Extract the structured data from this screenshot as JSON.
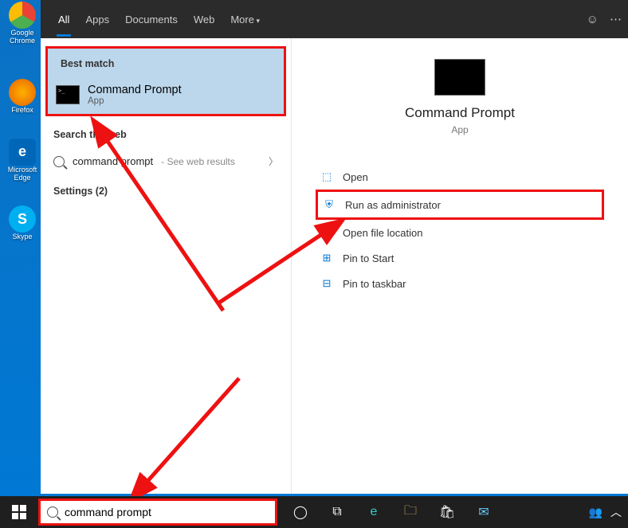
{
  "desktop": {
    "icons": [
      {
        "label": "Google Chrome",
        "color": "#fff"
      },
      {
        "label": "Firefox",
        "color": "#ff7139"
      },
      {
        "label": "Microsoft Edge",
        "color": "#0067b8"
      },
      {
        "label": "Skype",
        "color": "#00aff0"
      }
    ]
  },
  "tabs": {
    "items": [
      "All",
      "Apps",
      "Documents",
      "Web",
      "More"
    ],
    "active": 0
  },
  "left": {
    "best_match_label": "Best match",
    "best_match": {
      "title": "Command Prompt",
      "subtitle": "App"
    },
    "search_web_label": "Search the web",
    "web_query": "command prompt",
    "web_hint": " - See web results",
    "settings_label": "Settings (2)"
  },
  "right": {
    "title": "Command Prompt",
    "subtitle": "App",
    "actions": [
      {
        "key": "open",
        "label": "Open",
        "icon": "⬚"
      },
      {
        "key": "runadmin",
        "label": "Run as administrator",
        "icon": "⛨",
        "boxed": true
      },
      {
        "key": "openloc",
        "label": "Open file location",
        "icon": "🗀"
      },
      {
        "key": "pinstart",
        "label": "Pin to Start",
        "icon": "⊞"
      },
      {
        "key": "pintask",
        "label": "Pin to taskbar",
        "icon": "⊟"
      }
    ]
  },
  "taskbar": {
    "search_value": "command prompt",
    "icons": [
      "cortana",
      "taskview",
      "edge",
      "explorer",
      "store",
      "mail"
    ]
  }
}
